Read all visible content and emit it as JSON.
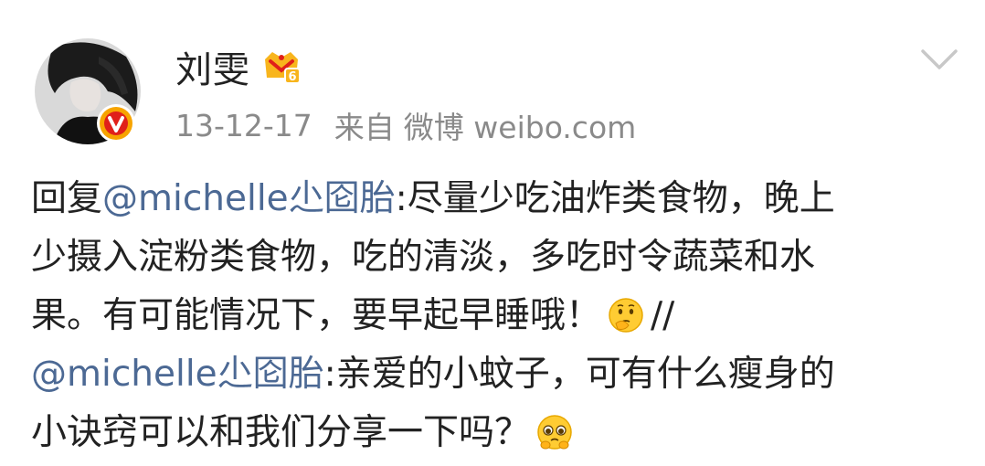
{
  "post": {
    "author": {
      "name": "刘雯",
      "avatar_icon": "avatar-photo",
      "verified_icon": "verified-v-icon",
      "vip_icon": "vip-crown-6-icon"
    },
    "meta": {
      "date": "13-12-17",
      "from_label": "来自",
      "client": "微博 weibo.com"
    },
    "menu_icon": "chevron-down-icon",
    "content": {
      "l1_prefix": "回复",
      "l1_mention": "@michelle尐囵胎",
      "l1_text": ":尽量少吃油炸类食物，晚上",
      "l2_text": "少摄入淀粉类食物，吃的清淡，多吃时令蔬菜和水",
      "l3_text": "果。有可能情况下，要早起早睡哦！",
      "l3_emoji": "thinking-emoji",
      "l3_separator": "//",
      "l4_mention": "@michelle尐囵胎",
      "l4_text": ":亲爱的小蚊子，可有什么瘦身的",
      "l5_text": "小诀窍可以和我们分享一下吗？",
      "l5_emoji": "pleading-emoji"
    }
  },
  "colors": {
    "text": "#222222",
    "meta": "#8a8a8a",
    "mention": "#4c6994",
    "verified": "#f7a400",
    "verified_inner": "#e0201a",
    "chevron": "#c8c8c8"
  }
}
